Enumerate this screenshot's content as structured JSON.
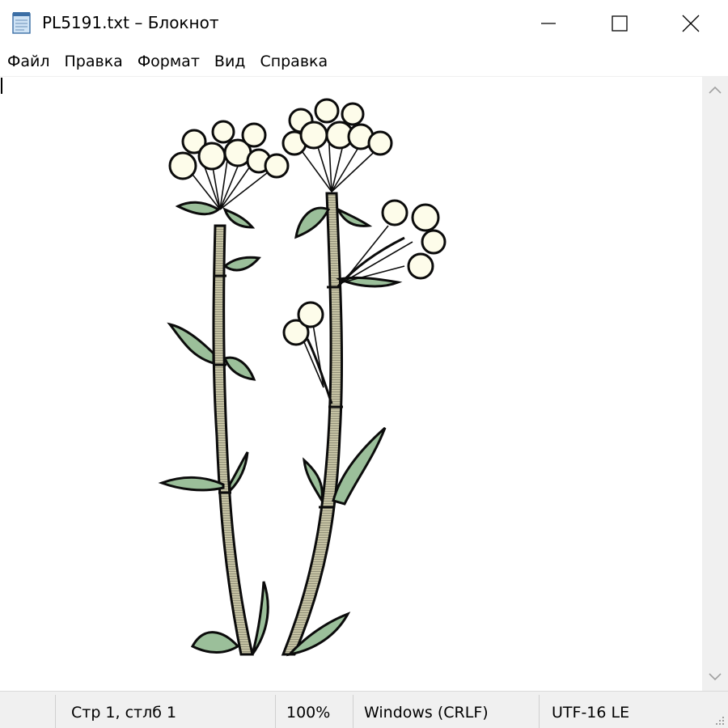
{
  "window": {
    "title": "PL5191.txt – Блокнот",
    "icon": "notepad-icon",
    "controls": {
      "minimize": "minimize-icon",
      "maximize": "maximize-icon",
      "close": "close-icon"
    }
  },
  "menu": {
    "items": [
      {
        "label": "Файл"
      },
      {
        "label": "Правка"
      },
      {
        "label": "Формат"
      },
      {
        "label": "Вид"
      },
      {
        "label": "Справка"
      }
    ]
  },
  "editor": {
    "content_icon": "ascii-art-flowers",
    "colors": {
      "flower": "#fdfcea",
      "leaf": "#9bbf9a",
      "stem": "#c5c2a3",
      "outline": "#0b0b0b"
    }
  },
  "statusbar": {
    "position": "Стр 1, стлб 1",
    "zoom": "100%",
    "line_endings": "Windows (CRLF)",
    "encoding": "UTF-16 LE"
  }
}
